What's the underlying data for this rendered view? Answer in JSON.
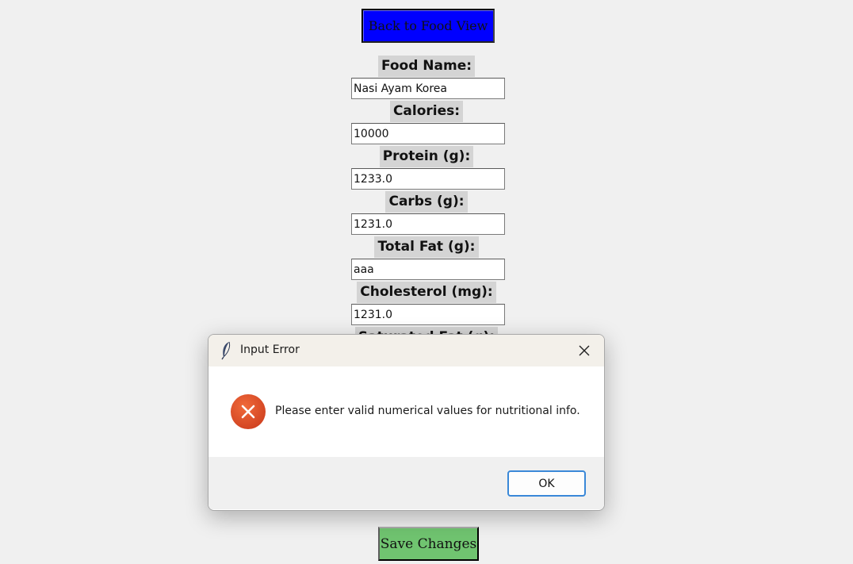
{
  "buttons": {
    "back_label": "Back to Food View",
    "save_label": "Save Changes"
  },
  "form": {
    "fields": [
      {
        "label": "Food Name:",
        "value": "Nasi Ayam Korea"
      },
      {
        "label": "Calories:",
        "value": "10000"
      },
      {
        "label": "Protein (g):",
        "value": "1233.0"
      },
      {
        "label": "Carbs (g):",
        "value": "1231.0"
      },
      {
        "label": "Total Fat (g):",
        "value": "aaa"
      },
      {
        "label": "Cholesterol (mg):",
        "value": "1231.0"
      }
    ],
    "partial_label": "Saturated Fat (g):"
  },
  "dialog": {
    "title": "Input Error",
    "message": "Please enter valid numerical values for nutritional info.",
    "ok_label": "OK",
    "icon": "error-icon",
    "close_icon": "close-icon",
    "title_icon": "feather-icon"
  },
  "colors": {
    "back_button": "#0000ff",
    "save_button": "#70c470",
    "error_icon": "#d84315",
    "ok_border": "#3a88d8"
  }
}
